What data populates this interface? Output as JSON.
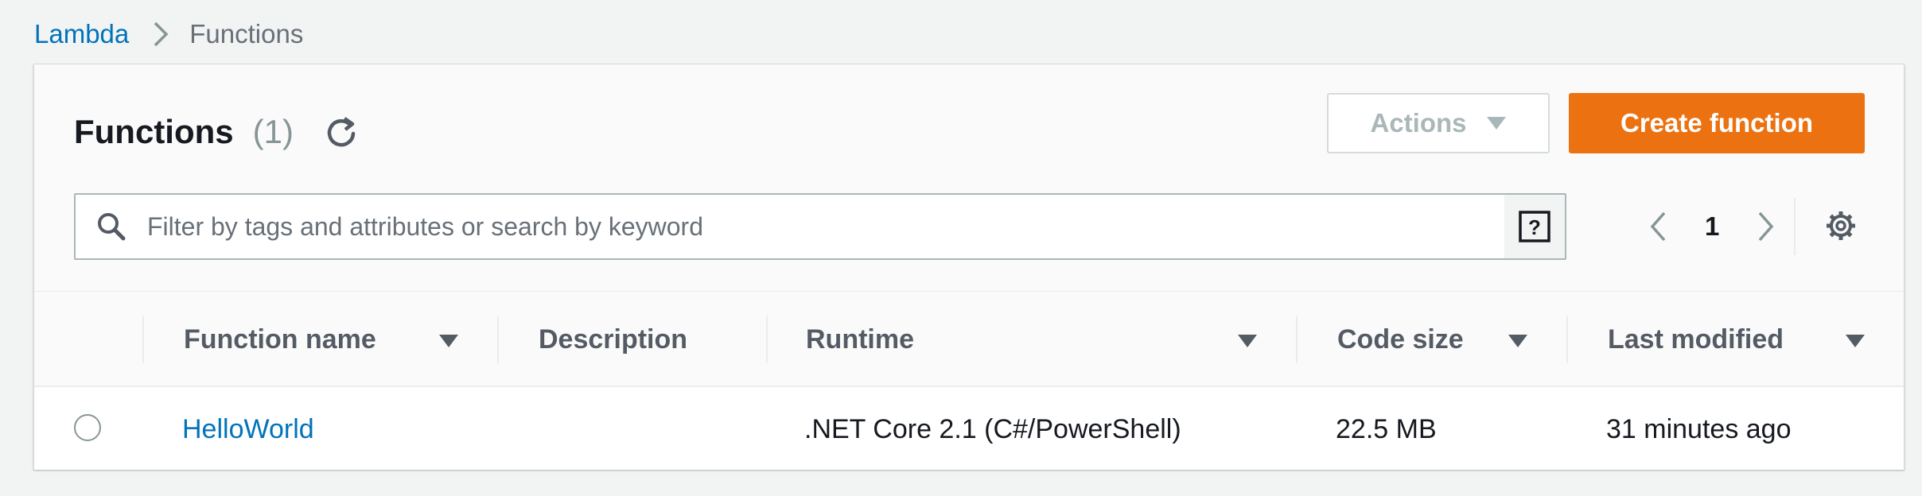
{
  "breadcrumb": {
    "root": "Lambda",
    "current": "Functions"
  },
  "header": {
    "title": "Functions",
    "count": "(1)",
    "actions_label": "Actions",
    "create_label": "Create function"
  },
  "search": {
    "placeholder": "Filter by tags and attributes or search by keyword",
    "value": ""
  },
  "pagination": {
    "current_page": "1"
  },
  "table": {
    "columns": [
      "Function name",
      "Description",
      "Runtime",
      "Code size",
      "Last modified"
    ],
    "rows": [
      {
        "function_name": "HelloWorld",
        "description": "",
        "runtime": ".NET Core 2.1 (C#/PowerShell)",
        "code_size": "22.5 MB",
        "last_modified": "31 minutes ago"
      }
    ]
  },
  "icons": {
    "breadcrumb_separator": "chevron-right-icon",
    "refresh": "refresh-icon",
    "actions_caret": "caret-down-icon",
    "search": "search-icon",
    "help": "help-icon",
    "prev": "chevron-left-icon",
    "next": "chevron-right-icon",
    "settings": "gear-icon",
    "sort": "caret-down-icon"
  },
  "colors": {
    "accent": "#ec7211",
    "link": "#0073bb",
    "page_bg": "#f2f3f3"
  }
}
